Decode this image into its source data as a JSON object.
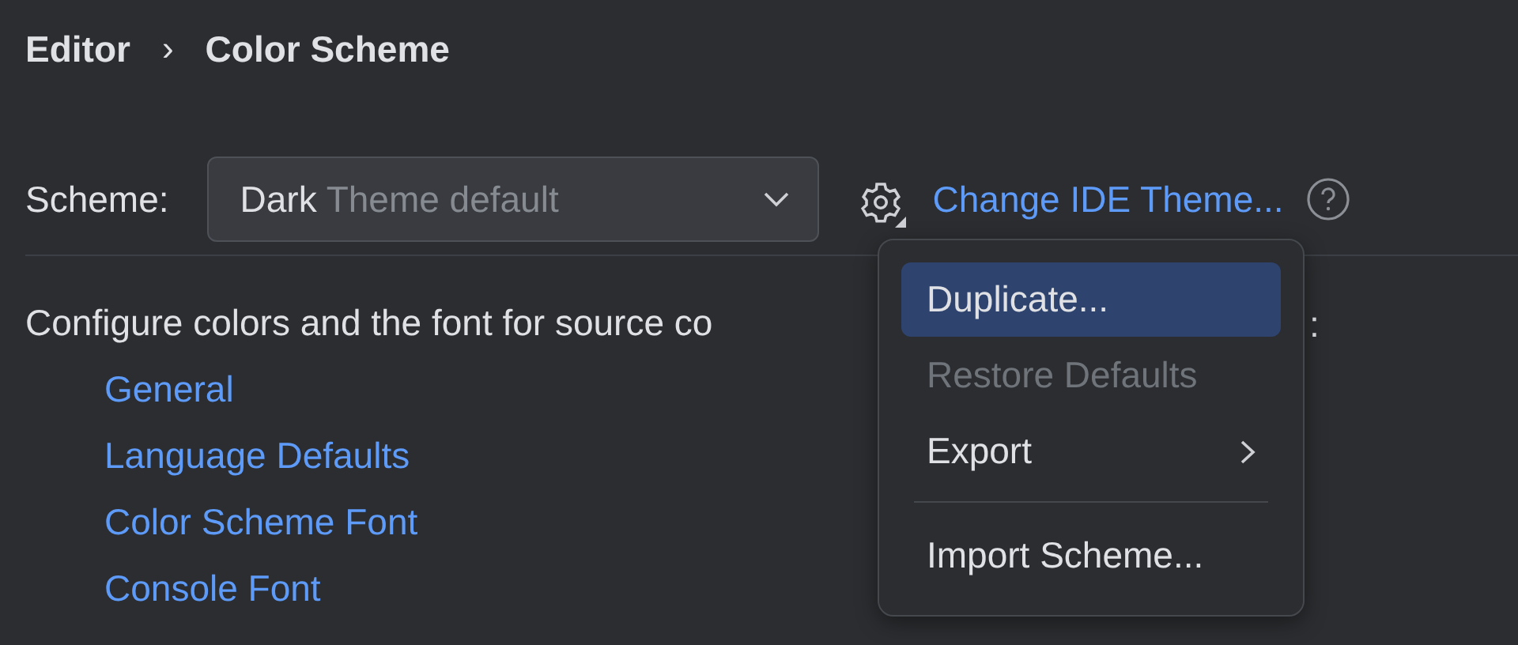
{
  "breadcrumb": [
    {
      "label": "Editor"
    },
    {
      "label": "Color Scheme"
    }
  ],
  "breadcrumb_separator": "›",
  "scheme": {
    "label": "Scheme:",
    "value": "Dark",
    "hint": "Theme default"
  },
  "theme_link": "Change IDE Theme...",
  "description": "Configure colors and the font for source co",
  "description_end": ":",
  "links": [
    "General",
    "Language Defaults",
    "Color Scheme Font",
    "Console Font"
  ],
  "menu": [
    {
      "kind": "item",
      "label": "Duplicate...",
      "selected": true,
      "disabled": false,
      "submenu": false
    },
    {
      "kind": "item",
      "label": "Restore Defaults",
      "selected": false,
      "disabled": true,
      "submenu": false
    },
    {
      "kind": "item",
      "label": "Export",
      "selected": false,
      "disabled": false,
      "submenu": true
    },
    {
      "kind": "separator"
    },
    {
      "kind": "item",
      "label": "Import Scheme...",
      "selected": false,
      "disabled": false,
      "submenu": false
    }
  ]
}
